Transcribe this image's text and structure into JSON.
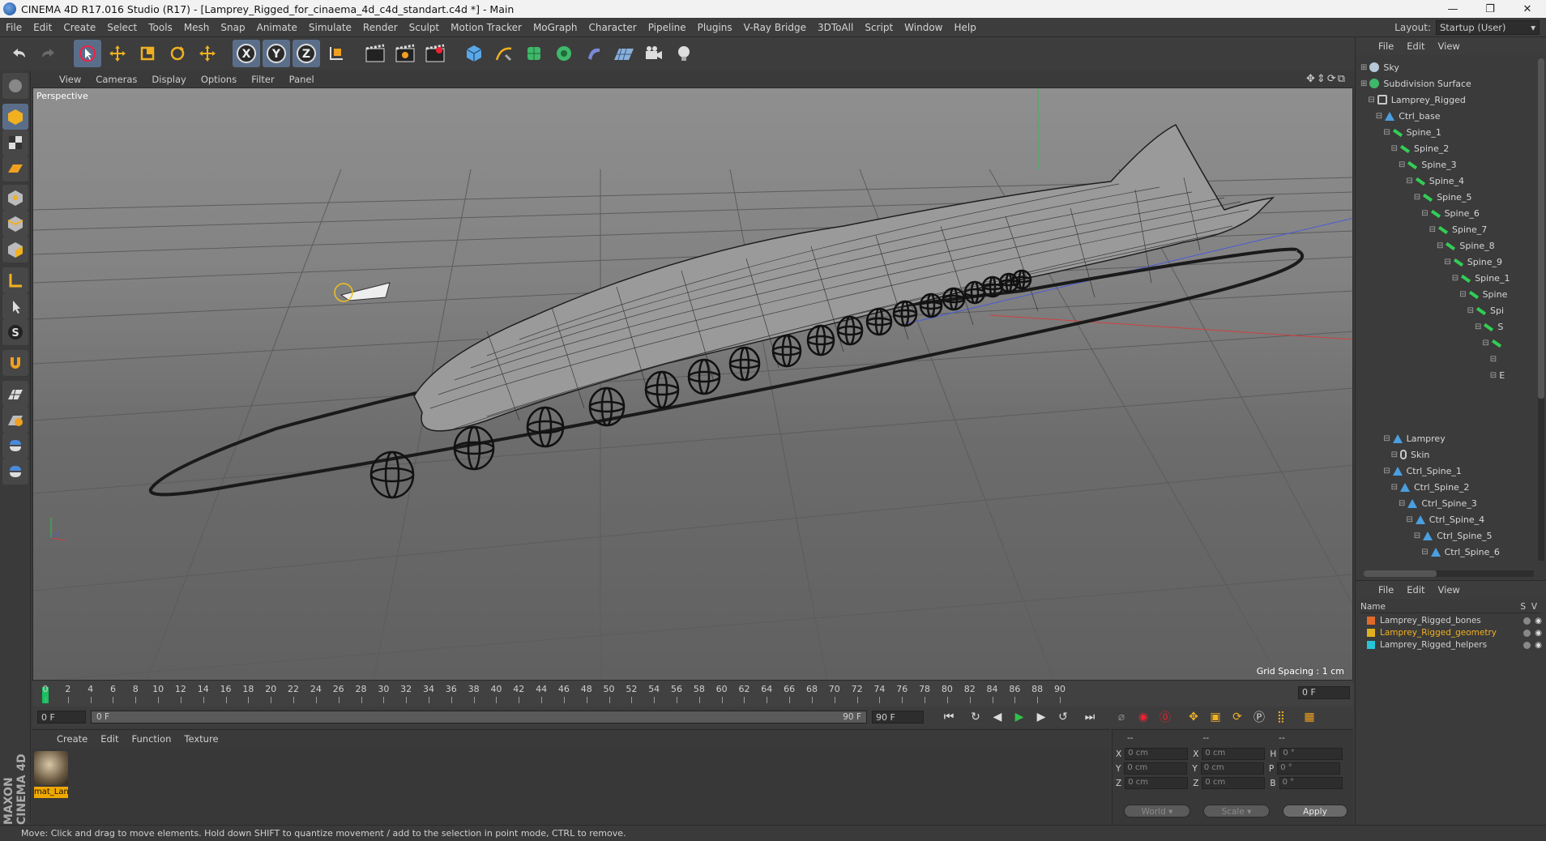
{
  "title": "CINEMA 4D R17.016 Studio (R17) - [Lamprey_Rigged_for_cinaema_4d_c4d_standart.c4d *] - Main",
  "window_buttons": [
    "—",
    "❐",
    "✕"
  ],
  "menus": [
    "File",
    "Edit",
    "Create",
    "Select",
    "Tools",
    "Mesh",
    "Snap",
    "Animate",
    "Simulate",
    "Render",
    "Sculpt",
    "Motion Tracker",
    "MoGraph",
    "Character",
    "Pipeline",
    "Plugins",
    "V-Ray Bridge",
    "3DToAll",
    "Script",
    "Window",
    "Help"
  ],
  "layout": {
    "label": "Layout:",
    "value": "Startup (User)"
  },
  "toolbar": {
    "axes": [
      "X",
      "Y",
      "Z"
    ]
  },
  "viewport": {
    "menus": [
      "View",
      "Cameras",
      "Display",
      "Options",
      "Filter",
      "Panel"
    ],
    "label": "Perspective",
    "grid_spacing": "Grid Spacing : 1 cm"
  },
  "timeline": {
    "ticks": [
      "0",
      "2",
      "4",
      "6",
      "8",
      "10",
      "12",
      "14",
      "16",
      "18",
      "20",
      "22",
      "24",
      "26",
      "28",
      "30",
      "32",
      "34",
      "36",
      "38",
      "40",
      "42",
      "44",
      "46",
      "48",
      "50",
      "52",
      "54",
      "56",
      "58",
      "60",
      "62",
      "64",
      "66",
      "68",
      "70",
      "72",
      "74",
      "76",
      "78",
      "80",
      "82",
      "84",
      "86",
      "88",
      "90"
    ],
    "frame_field": "0 F",
    "start": "0 F",
    "slider_left": "0 F",
    "slider_right": "90 F",
    "end": "90 F"
  },
  "material_manager": {
    "menus": [
      "Create",
      "Edit",
      "Function",
      "Texture"
    ],
    "materials": [
      {
        "name": "mat_Lan"
      }
    ]
  },
  "coordinates": {
    "headers": [
      "--",
      "--",
      "--"
    ],
    "rows": [
      {
        "a": "X",
        "a_val": "0 cm",
        "b": "X",
        "b_val": "0 cm",
        "c": "H",
        "c_val": "0 °"
      },
      {
        "a": "Y",
        "a_val": "0 cm",
        "b": "Y",
        "b_val": "0 cm",
        "c": "P",
        "c_val": "0 °"
      },
      {
        "a": "Z",
        "a_val": "0 cm",
        "b": "Z",
        "b_val": "0 cm",
        "c": "B",
        "c_val": "0 °"
      }
    ],
    "mode": "World",
    "scale": "Scale",
    "apply": "Apply"
  },
  "object_manager": {
    "menus": [
      "File",
      "Edit",
      "View"
    ],
    "items": [
      {
        "label": "Sky",
        "icon": "sky",
        "depth": 0
      },
      {
        "label": "Subdivision Surface",
        "icon": "sub",
        "depth": 0
      },
      {
        "label": "Lamprey_Rigged",
        "icon": "null",
        "depth": 1
      },
      {
        "label": "Ctrl_base",
        "icon": "joint",
        "depth": 2
      },
      {
        "label": "Spine_1",
        "icon": "bone",
        "depth": 3
      },
      {
        "label": "Spine_2",
        "icon": "bone",
        "depth": 4
      },
      {
        "label": "Spine_3",
        "icon": "bone",
        "depth": 5
      },
      {
        "label": "Spine_4",
        "icon": "bone",
        "depth": 6
      },
      {
        "label": "Spine_5",
        "icon": "bone",
        "depth": 7
      },
      {
        "label": "Spine_6",
        "icon": "bone",
        "depth": 8
      },
      {
        "label": "Spine_7",
        "icon": "bone",
        "depth": 9
      },
      {
        "label": "Spine_8",
        "icon": "bone",
        "depth": 10
      },
      {
        "label": "Spine_9",
        "icon": "bone",
        "depth": 11
      },
      {
        "label": "Spine_1",
        "icon": "bone",
        "depth": 12
      },
      {
        "label": "Spine",
        "icon": "bone",
        "depth": 13
      },
      {
        "label": "Spi",
        "icon": "bone",
        "depth": 14
      },
      {
        "label": "S",
        "icon": "bone",
        "depth": 15
      },
      {
        "label": "",
        "icon": "bone",
        "depth": 16
      },
      {
        "label": "",
        "icon": "none",
        "depth": 17
      },
      {
        "label": "E",
        "icon": "none",
        "depth": 17
      },
      {
        "label": "Lamprey",
        "icon": "joint",
        "depth": 3,
        "gap": true
      },
      {
        "label": "Skin",
        "icon": "skin",
        "depth": 4
      },
      {
        "label": "Ctrl_Spine_1",
        "icon": "joint",
        "depth": 3
      },
      {
        "label": "Ctrl_Spine_2",
        "icon": "joint",
        "depth": 4
      },
      {
        "label": "Ctrl_Spine_3",
        "icon": "joint",
        "depth": 5
      },
      {
        "label": "Ctrl_Spine_4",
        "icon": "joint",
        "depth": 6
      },
      {
        "label": "Ctrl_Spine_5",
        "icon": "joint",
        "depth": 7
      },
      {
        "label": "Ctrl_Spine_6",
        "icon": "joint",
        "depth": 8
      }
    ]
  },
  "layer_manager": {
    "menus": [
      "File",
      "Edit",
      "View"
    ],
    "header": {
      "name": "Name",
      "s": "S",
      "v": "V"
    },
    "layers": [
      {
        "name": "Lamprey_Rigged_bones",
        "color": "#e06a2a"
      },
      {
        "name": "Lamprey_Rigged_geometry",
        "color": "#e0b020"
      },
      {
        "name": "Lamprey_Rigged_helpers",
        "color": "#26c4d8"
      }
    ]
  },
  "status": "Move: Click and drag to move elements. Hold down SHIFT to quantize movement / add to the selection in point mode, CTRL to remove."
}
